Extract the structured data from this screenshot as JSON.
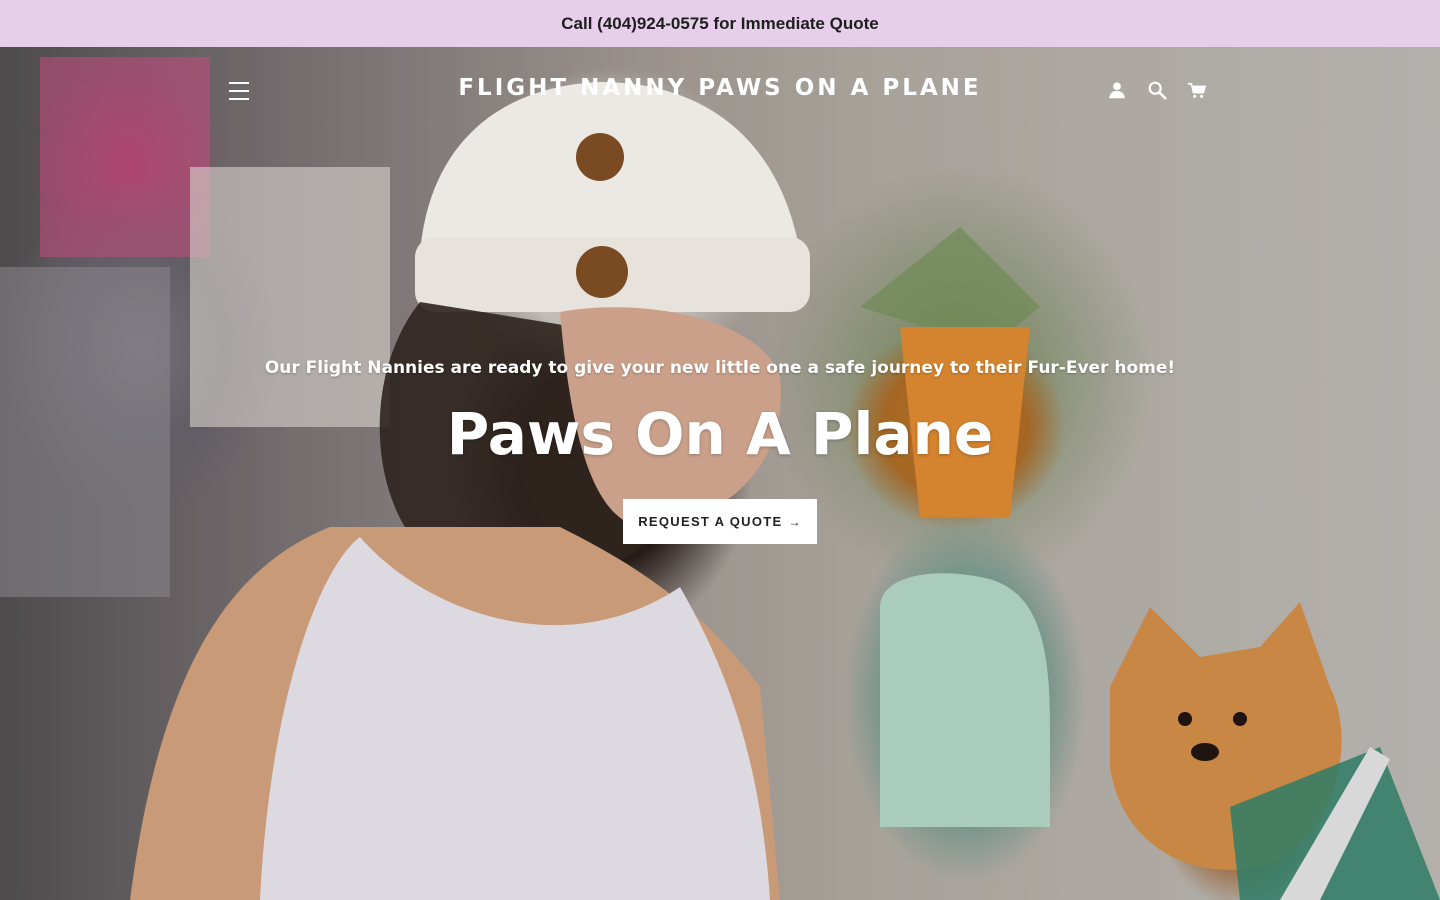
{
  "announcement": {
    "text": "Call (404)924-0575 for Immediate Quote"
  },
  "header": {
    "site_title": "FLIGHT NANNY PAWS ON A PLANE",
    "icons": [
      "menu-icon",
      "account-icon",
      "search-icon",
      "cart-icon"
    ]
  },
  "hero": {
    "tagline": "Our Flight Nannies are ready to give your new little one a safe journey to their Fur-Ever home!",
    "headline": "Paws On A Plane",
    "cta_label": "REQUEST A QUOTE",
    "cta_arrow": "→"
  },
  "colors": {
    "announcement_bg": "#e7cfeb",
    "cta_bg": "#ffffff",
    "text_light": "#ffffff",
    "text_dark": "#222222"
  }
}
